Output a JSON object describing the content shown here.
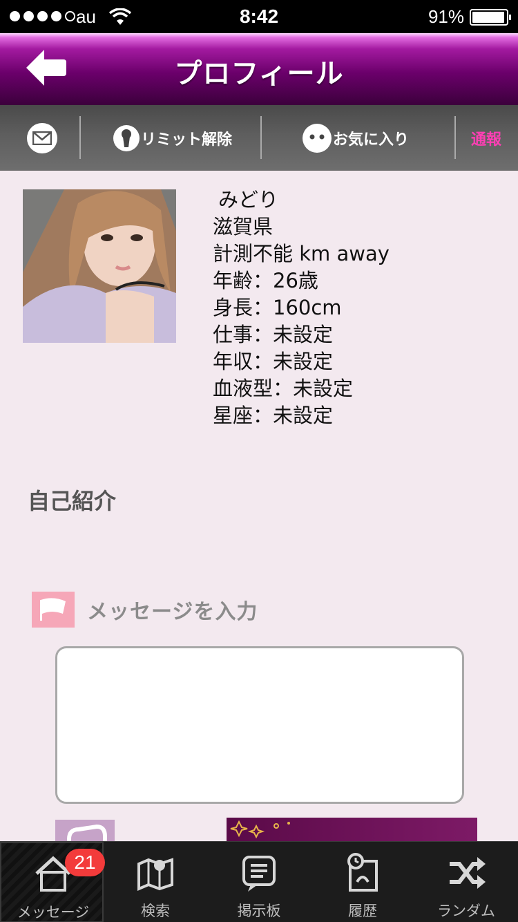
{
  "status_bar": {
    "carrier": "au",
    "time": "8:42",
    "battery": "91%"
  },
  "navbar": {
    "title": "プロフィール",
    "back_icon": "back-arrow-icon"
  },
  "actions": {
    "mail_icon": "mail-icon",
    "limit_label": "リミット解除",
    "favorite_label": "お気に入り",
    "report_label": "通報",
    "report_color": "#ff3fb4"
  },
  "profile": {
    "name": "みどり",
    "prefecture": "滋賀県",
    "distance": "計測不能 km away",
    "age": "年齢：26歳",
    "height": "身長：160cm",
    "job": "仕事：未設定",
    "income": "年収：未設定",
    "blood_type": "血液型：未設定",
    "zodiac": "星座：未設定"
  },
  "intro": {
    "title": "自己紹介",
    "body": ""
  },
  "message": {
    "label": "メッセージを入力",
    "value": "",
    "flag_color": "#f6a7b8"
  },
  "tabs": [
    {
      "label": "メッセージ",
      "icon": "home-icon",
      "badge": "21"
    },
    {
      "label": "検索",
      "icon": "map-icon"
    },
    {
      "label": "掲示板",
      "icon": "board-icon"
    },
    {
      "label": "履歴",
      "icon": "history-icon"
    },
    {
      "label": "ランダム",
      "icon": "shuffle-icon"
    }
  ],
  "colors": {
    "nav_purple": "#6b006b",
    "background": "#f3e9ef",
    "badge": "#f33b3b"
  }
}
